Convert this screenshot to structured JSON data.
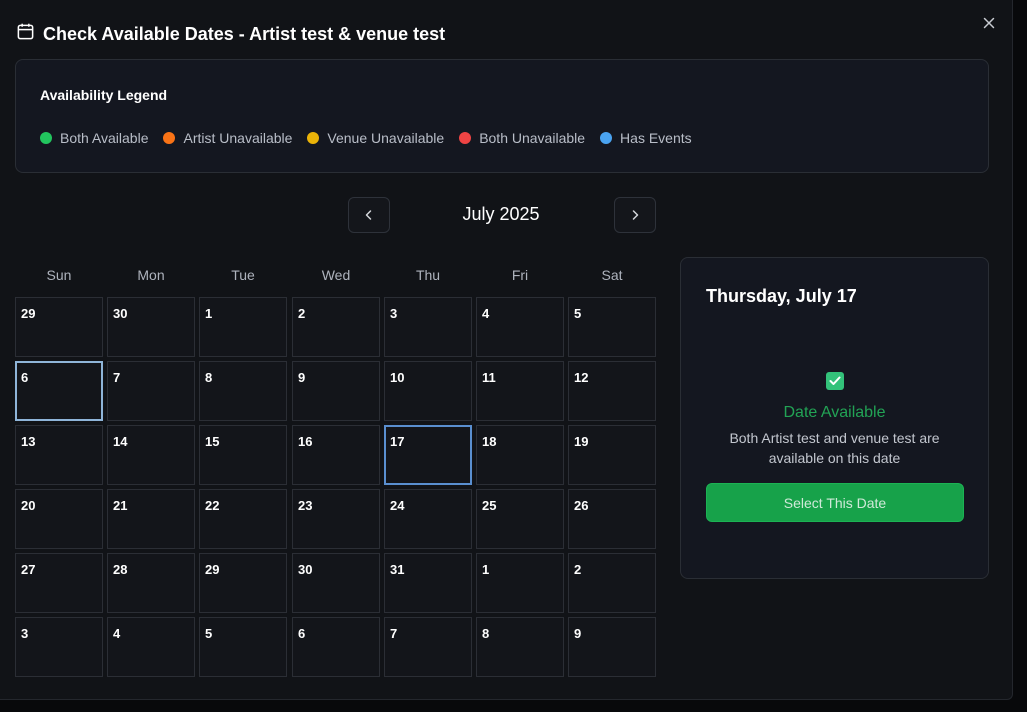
{
  "dialog": {
    "title": "Check Available Dates - Artist test & venue test",
    "calendar_icon": "calendar-icon",
    "close_icon": "close-icon",
    "close_symbol": "✕"
  },
  "legend": {
    "title": "Availability Legend",
    "items": [
      {
        "label": "Both Available",
        "color": "#22c55e"
      },
      {
        "label": "Artist Unavailable",
        "color": "#f97316"
      },
      {
        "label": "Venue Unavailable",
        "color": "#eab308"
      },
      {
        "label": "Both Unavailable",
        "color": "#ef4444"
      },
      {
        "label": "Has Events",
        "color": "#4aa3f0"
      }
    ]
  },
  "calendar": {
    "month_label": "July 2025",
    "prev_icon": "chevron-left-icon",
    "next_icon": "chevron-right-icon",
    "weekdays": [
      "Sun",
      "Mon",
      "Tue",
      "Wed",
      "Thu",
      "Fri",
      "Sat"
    ],
    "weeks": [
      [
        "29",
        "30",
        "1",
        "2",
        "3",
        "4",
        "5"
      ],
      [
        "6",
        "7",
        "8",
        "9",
        "10",
        "11",
        "12"
      ],
      [
        "13",
        "14",
        "15",
        "16",
        "17",
        "18",
        "19"
      ],
      [
        "20",
        "21",
        "22",
        "23",
        "24",
        "25",
        "26"
      ],
      [
        "27",
        "28",
        "29",
        "30",
        "31",
        "1",
        "2"
      ],
      [
        "3",
        "4",
        "5",
        "6",
        "7",
        "8",
        "9"
      ]
    ],
    "today": "6",
    "selected": "17"
  },
  "panel": {
    "date_label": "Thursday, July 17",
    "status_icon": "check-icon",
    "status_color": "#22a355",
    "status": "Date Available",
    "description": "Both Artist test and venue test are available on this date",
    "button_label": "Select This Date",
    "button_color": "#17a24a"
  }
}
